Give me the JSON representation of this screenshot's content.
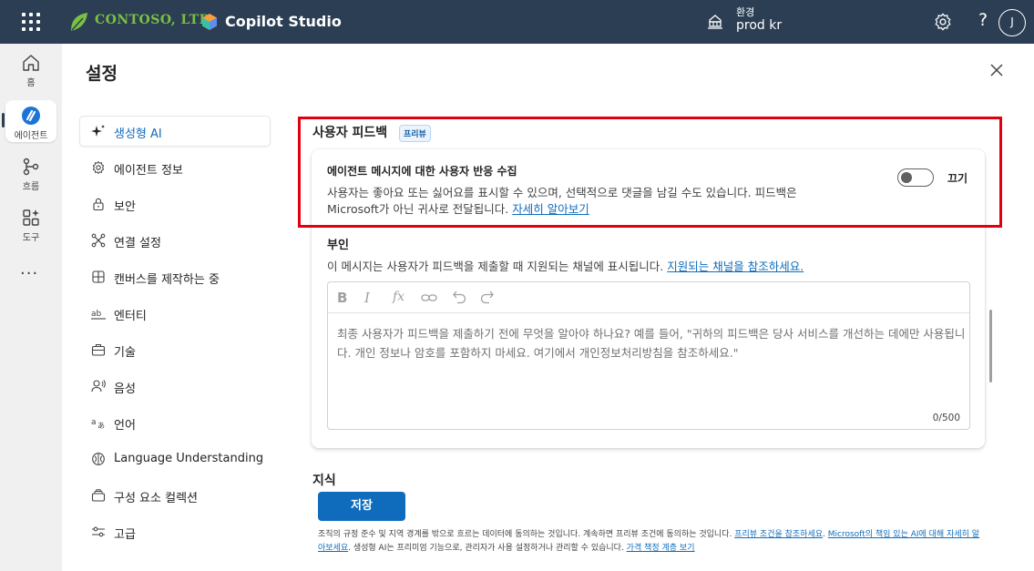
{
  "topbar": {
    "org_name": "CONTOSO, LTD.",
    "product_name": "Copilot Studio",
    "env_label": "환경",
    "env_value": "prod kr",
    "help_label": "?",
    "avatar_initial": "J",
    "brand_color": "#2b3e53"
  },
  "rail": {
    "items": [
      {
        "label": "홈",
        "icon": "home-icon"
      },
      {
        "label": "에이전트",
        "icon": "agent-icon"
      },
      {
        "label": "흐름",
        "icon": "flow-icon"
      },
      {
        "label": "도구",
        "icon": "tools-icon"
      }
    ],
    "more": "···"
  },
  "panel": {
    "title": "설정"
  },
  "nav": {
    "items": [
      {
        "label": "생성형 AI",
        "icon": "sparkle-icon",
        "active": true
      },
      {
        "label": "에이전트 정보",
        "icon": "gear-icon"
      },
      {
        "label": "보안",
        "icon": "lock-icon"
      },
      {
        "label": "연결 설정",
        "icon": "connection-icon"
      },
      {
        "label": "캔버스를 제작하는 중",
        "icon": "canvas-icon"
      },
      {
        "label": "엔터티",
        "icon": "entity-icon"
      },
      {
        "label": "기술",
        "icon": "briefcase-icon"
      },
      {
        "label": "음성",
        "icon": "voice-icon"
      },
      {
        "label": "언어",
        "icon": "language-icon"
      },
      {
        "label": "Language Understanding",
        "icon": "brain-icon"
      },
      {
        "label": "구성 요소 컬렉션",
        "icon": "collection-icon"
      },
      {
        "label": "고급",
        "icon": "sliders-icon"
      }
    ]
  },
  "feedback": {
    "section_title": "사용자 피드백",
    "badge": "프리뷰",
    "title": "에이전트 메시지에 대한 사용자 반응 수집",
    "desc_line1": "사용자는 좋아요 또는 싫어요를 표시할 수 있으며, 선택적으로 댓글을 남길 수도 있습니다. 피드백은",
    "desc_line2": "Microsoft가 아닌 귀사로 전달됩니다.",
    "learn_more": "자세히 알아보기",
    "toggle_label": "끄기",
    "toggle_on": false
  },
  "disclaimer": {
    "title": "부인",
    "desc": "이 메시지는 사용자가 피드백을 제출할 때 지원되는 채널에 표시됩니다.",
    "desc_link": "지원되는 채널을 참조하세요.",
    "placeholder": "최종 사용자가 피드백을 제출하기 전에 무엇을 알아야 하나요? 예를 들어, \"귀하의 피드백은 당사 서비스를 개선하는 데에만 사용됩니다. 개인 정보나 암호를 포함하지 마세요. 여기에서 개인정보처리방침을 참조하세요.\"",
    "char_count": "0/500",
    "toolbar": [
      "bold-icon",
      "italic-icon",
      "formula-icon",
      "link-icon",
      "undo-icon",
      "redo-icon"
    ]
  },
  "knowledge": {
    "title": "지식",
    "save_label": "저장"
  },
  "footer": {
    "text1": "조직의 규정 준수 및 지역 경계를 밖으로 흐르는 데이터에 동의하는 것입니다. 계속하면 프리뷰 조건에 동의하는 것입니다. ",
    "link1": "프리뷰 조건을 참조하세요",
    "text2": ". ",
    "link2": "Microsoft의 책임 있는 AI에 대해 자세히 알아보세요",
    "text3": ". 생성형 AI는 프리미엄 기능으로, 관리자가 사용 설정하거나 관리할 수 있습니다. ",
    "link3": "가격 책정 계층 보기"
  }
}
